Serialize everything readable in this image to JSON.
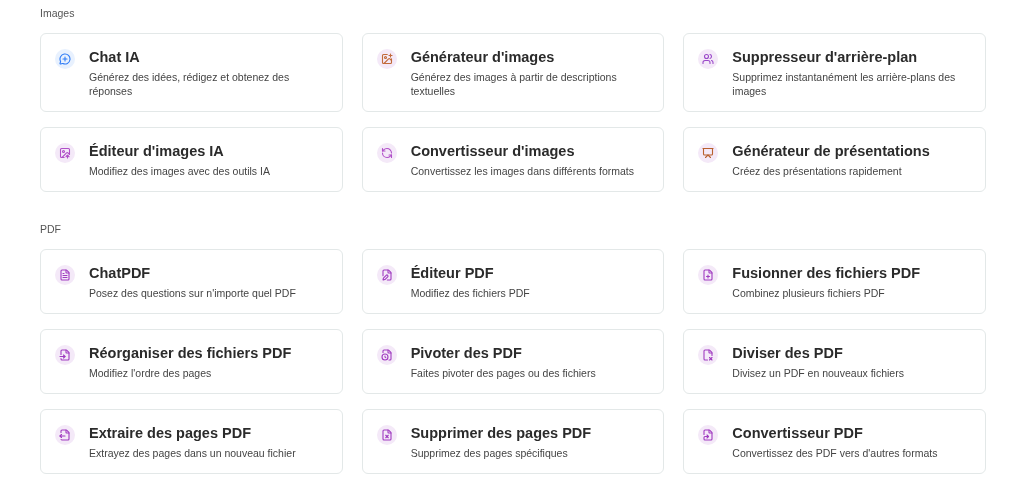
{
  "sections": [
    {
      "title": "Images",
      "cards": [
        {
          "kind": "chat",
          "title": "Chat IA",
          "description": "Générez des idées, rédigez et obtenez des réponses"
        },
        {
          "kind": "image-sparkle",
          "title": "Générateur d'images",
          "description": "Générez des images à partir de descriptions textuelles"
        },
        {
          "kind": "person-cutout",
          "title": "Suppresseur d'arrière-plan",
          "description": "Supprimez instantanément les arrière-plans des images"
        },
        {
          "kind": "image-pen",
          "title": "Éditeur d'images IA",
          "description": "Modifiez des images avec des outils IA"
        },
        {
          "kind": "image-refresh",
          "title": "Convertisseur d'images",
          "description": "Convertissez les images dans différents formats"
        },
        {
          "kind": "presentation",
          "title": "Générateur de présentations",
          "description": "Créez des présentations rapidement"
        }
      ]
    },
    {
      "title": "PDF",
      "cards": [
        {
          "kind": "file-chat",
          "title": "ChatPDF",
          "description": "Posez des questions sur n'importe quel PDF"
        },
        {
          "kind": "file-pen",
          "title": "Éditeur PDF",
          "description": "Modifiez des fichiers PDF"
        },
        {
          "kind": "file-plus",
          "title": "Fusionner des fichiers PDF",
          "description": "Combinez plusieurs fichiers PDF"
        },
        {
          "kind": "file-arrow",
          "title": "Réorganiser des fichiers PDF",
          "description": "Modifiez l'ordre des pages"
        },
        {
          "kind": "file-rotate",
          "title": "Pivoter des PDF",
          "description": "Faites pivoter des pages ou des fichiers"
        },
        {
          "kind": "file-scissors",
          "title": "Diviser des PDF",
          "description": "Divisez un PDF en nouveaux fichiers"
        },
        {
          "kind": "file-output",
          "title": "Extraire des pages PDF",
          "description": "Extrayez des pages dans un nouveau fichier"
        },
        {
          "kind": "file-x",
          "title": "Supprimer des pages PDF",
          "description": "Supprimez des pages spécifiques"
        },
        {
          "kind": "file-convert",
          "title": "Convertisseur PDF",
          "description": "Convertissez des PDF vers d'autres formats"
        }
      ]
    }
  ]
}
